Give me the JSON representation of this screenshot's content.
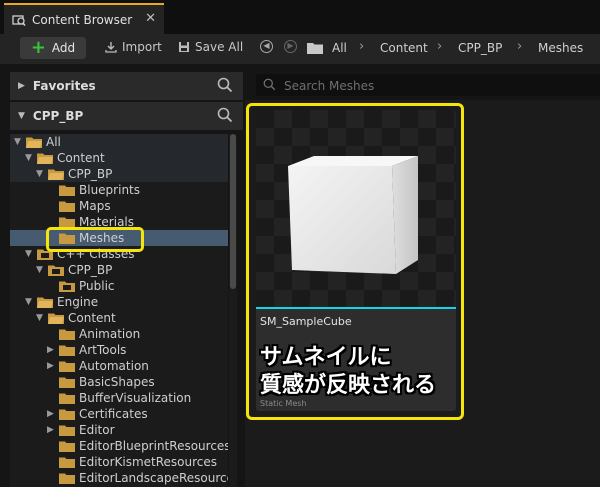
{
  "tab": {
    "title": "Content Browser",
    "close": "✕"
  },
  "toolbar": {
    "add_label": "Add",
    "import_label": "Import",
    "save_all_label": "Save All"
  },
  "breadcrumb": [
    "All",
    "Content",
    "CPP_BP",
    "Meshes"
  ],
  "favorites": {
    "label": "Favorites"
  },
  "project": {
    "label": "CPP_BP"
  },
  "tree": [
    {
      "label": "All",
      "indent": 0,
      "exp": "▼",
      "folder": "open",
      "selected": false,
      "alt": true
    },
    {
      "label": "Content",
      "indent": 1,
      "exp": "▼",
      "folder": "open",
      "selected": false,
      "alt": true
    },
    {
      "label": "CPP_BP",
      "indent": 2,
      "exp": "▼",
      "folder": "open",
      "selected": false,
      "alt": true
    },
    {
      "label": "Blueprints",
      "indent": 3,
      "exp": "",
      "folder": "closed",
      "selected": false
    },
    {
      "label": "Maps",
      "indent": 3,
      "exp": "",
      "folder": "closed",
      "selected": false
    },
    {
      "label": "Materials",
      "indent": 3,
      "exp": "",
      "folder": "closed",
      "selected": false
    },
    {
      "label": "Meshes",
      "indent": 3,
      "exp": "",
      "folder": "closed",
      "selected": true
    },
    {
      "label": "C++ Classes",
      "indent": 1,
      "exp": "▼",
      "folder": "cpp",
      "selected": false
    },
    {
      "label": "CPP_BP",
      "indent": 2,
      "exp": "▼",
      "folder": "cpp",
      "selected": false
    },
    {
      "label": "Public",
      "indent": 3,
      "exp": "",
      "folder": "cpp",
      "selected": false
    },
    {
      "label": "Engine",
      "indent": 1,
      "exp": "▼",
      "folder": "open",
      "selected": false
    },
    {
      "label": "Content",
      "indent": 2,
      "exp": "▼",
      "folder": "open",
      "selected": false
    },
    {
      "label": "Animation",
      "indent": 3,
      "exp": "",
      "folder": "closed",
      "selected": false
    },
    {
      "label": "ArtTools",
      "indent": 3,
      "exp": "▶",
      "folder": "closed",
      "selected": false
    },
    {
      "label": "Automation",
      "indent": 3,
      "exp": "▶",
      "folder": "closed",
      "selected": false
    },
    {
      "label": "BasicShapes",
      "indent": 3,
      "exp": "",
      "folder": "closed",
      "selected": false
    },
    {
      "label": "BufferVisualization",
      "indent": 3,
      "exp": "",
      "folder": "closed",
      "selected": false
    },
    {
      "label": "Certificates",
      "indent": 3,
      "exp": "▶",
      "folder": "closed",
      "selected": false
    },
    {
      "label": "Editor",
      "indent": 3,
      "exp": "▶",
      "folder": "closed",
      "selected": false
    },
    {
      "label": "EditorBlueprintResources",
      "indent": 3,
      "exp": "",
      "folder": "closed",
      "selected": false
    },
    {
      "label": "EditorKismetResources",
      "indent": 3,
      "exp": "",
      "folder": "closed",
      "selected": false
    },
    {
      "label": "EditorLandscapeResources",
      "indent": 3,
      "exp": "",
      "folder": "closed",
      "selected": false
    }
  ],
  "search": {
    "placeholder": "Search Meshes",
    "value": ""
  },
  "asset": {
    "name": "SM_SampleCube",
    "type": "Static Mesh"
  },
  "annotation": {
    "line1": "サムネイルに",
    "line2": "質感が反映される"
  },
  "colors": {
    "highlight": "#f5e50a",
    "thumbnail_line": "#16d3e8",
    "folder": "#c79a42",
    "add_plus": "#36c53a",
    "tab_accent": "#e7a823"
  },
  "icons": [
    "content-browser-icon",
    "close-icon",
    "plus-icon",
    "import-icon",
    "save-icon",
    "back-icon",
    "forward-icon",
    "folder-icon",
    "chevron-right-icon",
    "search-icon"
  ]
}
